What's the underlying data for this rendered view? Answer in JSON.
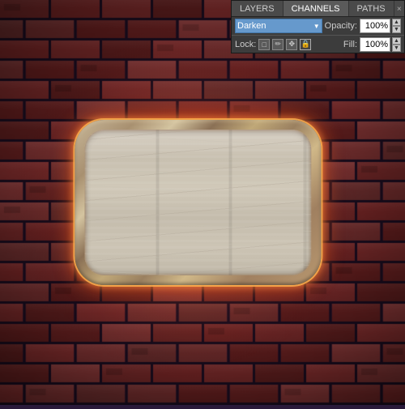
{
  "panel": {
    "tabs": [
      {
        "id": "layers",
        "label": "LAYERS",
        "active": false
      },
      {
        "id": "channels",
        "label": "CHANNELS",
        "active": true
      },
      {
        "id": "paths",
        "label": "PATHS",
        "active": false
      }
    ],
    "close_btn": "×",
    "blend_mode": {
      "label": "",
      "value": "Darken",
      "arrow": "▼"
    },
    "opacity": {
      "label": "Opacity:",
      "value": "100%",
      "arrow_up": "▲",
      "arrow_down": "▼"
    },
    "lock": {
      "label": "Lock:",
      "icons": [
        "□",
        "✏",
        "✥",
        "🔒"
      ]
    },
    "fill": {
      "label": "Fill:",
      "value": "100%",
      "arrow_up": "▲",
      "arrow_down": "▼"
    }
  },
  "colors": {
    "accent_blue": "#6699cc",
    "panel_bg": "#3c3c3c",
    "tab_active": "#5a5a5a",
    "tab_inactive": "#4a4a4a",
    "text_light": "#cccccc",
    "text_white": "#ffffff",
    "border_dark": "#222222"
  }
}
